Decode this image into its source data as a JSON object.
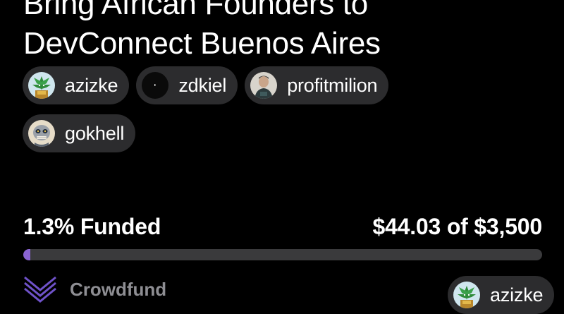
{
  "title": {
    "line1": "Bring African Founders to",
    "line2": "DevConnect Buenos Aires"
  },
  "contributors": [
    {
      "name": "azizke",
      "avatar_icon": "cactus-avatar-icon"
    },
    {
      "name": "zdkiel",
      "avatar_icon": "dark-dot-avatar-icon"
    },
    {
      "name": "profitmilion",
      "avatar_icon": "person-photo-avatar-icon"
    },
    {
      "name": "gokhell",
      "avatar_icon": "skull-avatar-icon"
    }
  ],
  "funding": {
    "percent_label": "1.3% Funded",
    "amount_label": "$44.03 of $3,500",
    "progress_fraction": 0.013
  },
  "brand": {
    "name": "Crowdfund",
    "logo_icon": "crowdfund-logo-icon"
  },
  "creator": {
    "name": "azizke",
    "avatar_icon": "cactus-avatar-icon"
  },
  "colors": {
    "background": "#000000",
    "chip": "#2c2c2e",
    "progress_track": "#3a3a3c",
    "progress_fill": "#8a63d2",
    "brand_logo": "#6f52c9",
    "brand_text": "#8e8e93"
  }
}
